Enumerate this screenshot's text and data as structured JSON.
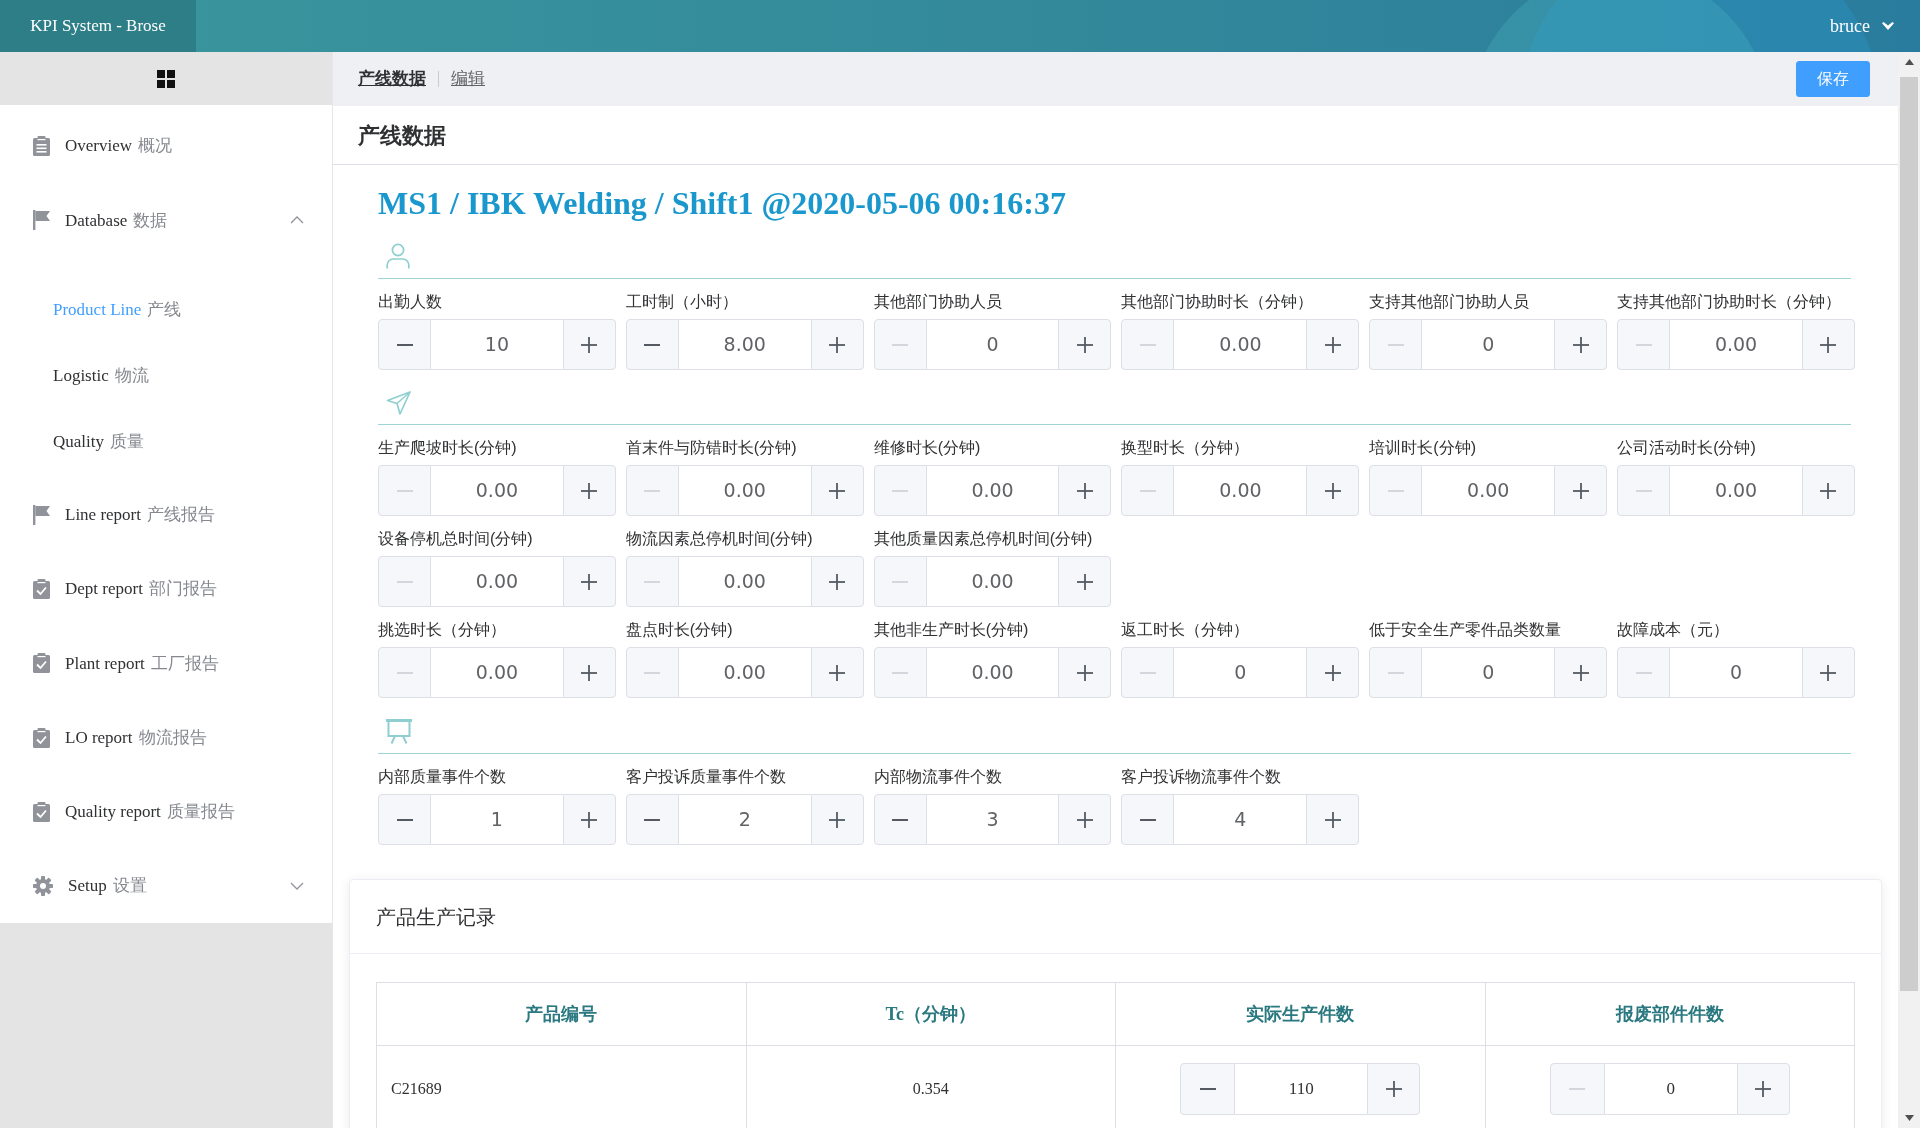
{
  "top_bar": {
    "app_title": "KPI System - Brose",
    "user": "bruce"
  },
  "sidebar": {
    "items": [
      {
        "label": "Overview",
        "label_cn": "概况",
        "selected": false
      },
      {
        "label": "Database",
        "label_cn": "数据",
        "selected": false,
        "expanded": true,
        "children": [
          {
            "label": "Product Line",
            "label_cn": "产线",
            "selected": true
          },
          {
            "label": "Logistic",
            "label_cn": "物流",
            "selected": false
          },
          {
            "label": "Quality",
            "label_cn": "质量",
            "selected": false
          }
        ]
      },
      {
        "label": "Line report",
        "label_cn": "产线报告",
        "selected": false
      },
      {
        "label": "Dept report",
        "label_cn": "部门报告",
        "selected": false
      },
      {
        "label": "Plant report",
        "label_cn": "工厂报告",
        "selected": false
      },
      {
        "label": "LO report",
        "label_cn": "物流报告",
        "selected": false
      },
      {
        "label": "Quality report",
        "label_cn": "质量报告",
        "selected": false
      },
      {
        "label": "Setup",
        "label_cn": "设置",
        "selected": false,
        "expanded": false
      }
    ]
  },
  "breadcrumb": [
    "产线数据",
    "编辑"
  ],
  "save_button": "保存",
  "page_header": "产线数据",
  "record_title": "MS1 / IBK Welding / Shift1 @2020-05-06 00:16:37",
  "sections": [
    {
      "rows": [
        {
          "fields": [
            {
              "label": "出勤人数",
              "value": "10",
              "decrement_disabled": false
            },
            {
              "label": "工时制（小时）",
              "value": "8.00",
              "decrement_disabled": false
            },
            {
              "label": "其他部门协助人员",
              "value": "0",
              "decrement_disabled": true
            },
            {
              "label": "其他部门协助时长（分钟）",
              "value": "0.00",
              "decrement_disabled": true
            },
            {
              "label": "支持其他部门协助人员",
              "value": "0",
              "decrement_disabled": true
            },
            {
              "label": "支持其他部门协助时长（分钟）",
              "value": "0.00",
              "decrement_disabled": true
            }
          ]
        }
      ]
    },
    {
      "rows": [
        {
          "fields": [
            {
              "label": "生产爬坡时长(分钟)",
              "value": "0.00",
              "decrement_disabled": true
            },
            {
              "label": "首末件与防错时长(分钟)",
              "value": "0.00",
              "decrement_disabled": true
            },
            {
              "label": "维修时长(分钟)",
              "value": "0.00",
              "decrement_disabled": true
            },
            {
              "label": "换型时长（分钟）",
              "value": "0.00",
              "decrement_disabled": true
            },
            {
              "label": "培训时长(分钟)",
              "value": "0.00",
              "decrement_disabled": true
            },
            {
              "label": "公司活动时长(分钟)",
              "value": "0.00",
              "decrement_disabled": true
            }
          ]
        },
        {
          "fields": [
            {
              "label": "设备停机总时间(分钟)",
              "value": "0.00",
              "decrement_disabled": true
            },
            {
              "label": "物流因素总停机时间(分钟)",
              "value": "0.00",
              "decrement_disabled": true
            },
            {
              "label": "其他质量因素总停机时间(分钟)",
              "value": "0.00",
              "decrement_disabled": true
            }
          ]
        },
        {
          "fields": [
            {
              "label": "挑选时长（分钟）",
              "value": "0.00",
              "decrement_disabled": true
            },
            {
              "label": "盘点时长(分钟)",
              "value": "0.00",
              "decrement_disabled": true
            },
            {
              "label": "其他非生产时长(分钟)",
              "value": "0.00",
              "decrement_disabled": true
            },
            {
              "label": "返工时长（分钟）",
              "value": "0",
              "decrement_disabled": true
            },
            {
              "label": "低于安全生产零件品类数量",
              "value": "0",
              "decrement_disabled": true
            },
            {
              "label": "故障成本（元）",
              "value": "0",
              "decrement_disabled": true
            }
          ]
        }
      ]
    },
    {
      "rows": [
        {
          "fields": [
            {
              "label": "内部质量事件个数",
              "value": "1",
              "decrement_disabled": false
            },
            {
              "label": "客户投诉质量事件个数",
              "value": "2",
              "decrement_disabled": false
            },
            {
              "label": "内部物流事件个数",
              "value": "3",
              "decrement_disabled": false
            },
            {
              "label": "客户投诉物流事件个数",
              "value": "4",
              "decrement_disabled": false
            }
          ]
        }
      ]
    }
  ],
  "production_records": {
    "title": "产品生产记录",
    "columns": [
      "产品编号",
      "Tc（分钟）",
      "实际生产件数",
      "报废部件件数"
    ],
    "rows": [
      {
        "cells": [
          {
            "kind": "text",
            "text": "C21689"
          },
          {
            "kind": "text",
            "text": "0.354"
          },
          {
            "kind": "stepper",
            "value": "110",
            "decrement_disabled": false
          },
          {
            "kind": "stepper",
            "value": "0",
            "decrement_disabled": true
          }
        ]
      }
    ]
  }
}
